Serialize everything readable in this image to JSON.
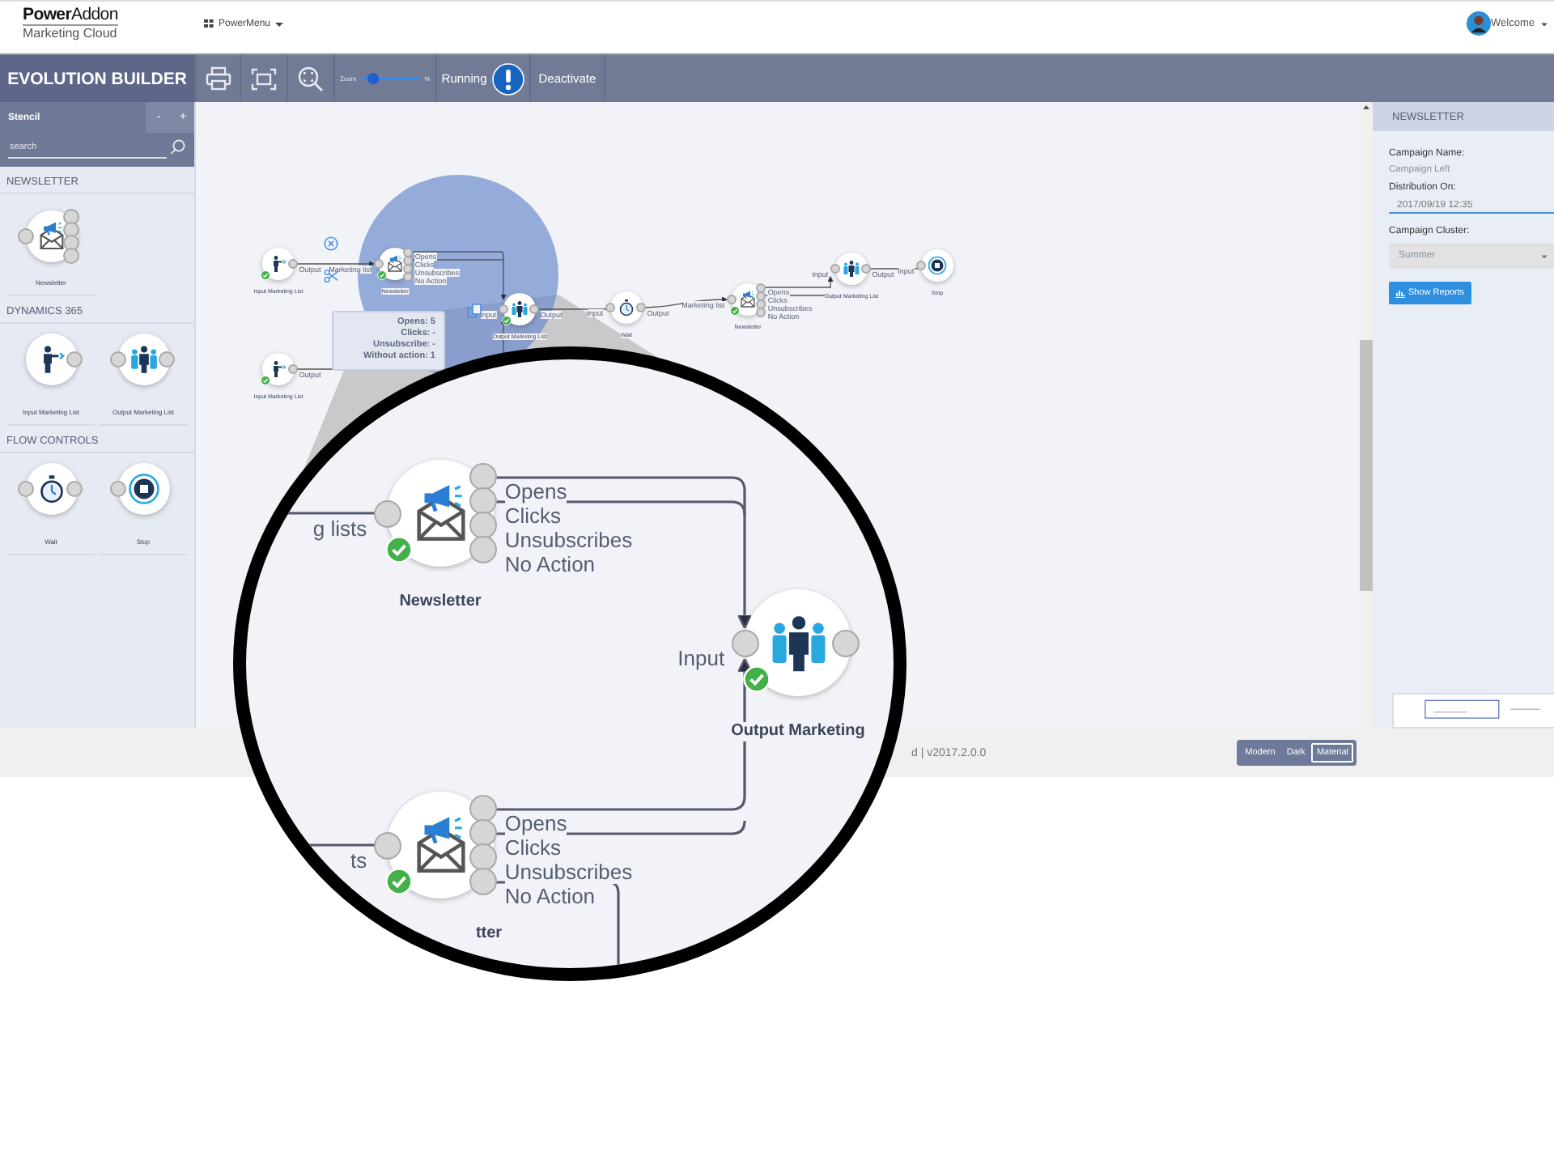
{
  "header": {
    "logo": "**Power**Addon",
    "logo_subtitle": "Marketing Cloud",
    "menu": "PowerMenu",
    "user": "Welcome"
  },
  "toolbar": {
    "title": "EVOLUTION BUILDER",
    "zoom_label": "Zoom",
    "zoom": {
      "level": 0.2
    },
    "zoom_unit": "%",
    "status": "Running",
    "action": "Deactivate"
  },
  "stencil": {
    "title": "Stencil",
    "buttons": [
      "-",
      "+"
    ],
    "search": {
      "placeholder": "search"
    },
    "groups": [
      {
        "title": "NEWSLETTER",
        "items": [
          {
            "kind": "newsletter",
            "label": "Newsletter"
          }
        ]
      },
      {
        "title": "DYNAMICS 365",
        "items": [
          {
            "kind": "input-list",
            "label": "Input Marketing List"
          },
          {
            "kind": "output-list",
            "label": "Output Marketing List"
          }
        ]
      },
      {
        "title": "FLOW CONTROLS",
        "items": [
          {
            "kind": "wait",
            "label": "Wait"
          },
          {
            "kind": "stop",
            "label": "Stop"
          }
        ]
      }
    ]
  },
  "canvas": {
    "nodes": [
      {
        "kind": "input-list",
        "label": "Input Marketing List",
        "done": true,
        "output": "Output"
      },
      {
        "kind": "newsletter",
        "label": "Newsletter",
        "done": true,
        "input": "Marketing list",
        "options": [
          "Opens",
          "Clicks",
          "Unsubscribes",
          "No Action"
        ]
      },
      {
        "kind": "output-list",
        "label": "Output Marketing List",
        "done": true,
        "input": "Input",
        "output": "Output"
      },
      {
        "kind": "wait",
        "label": "Wait",
        "done": false,
        "input": "Input",
        "output": "Output"
      },
      {
        "kind": "newsletter",
        "label": "Newsletter",
        "done": true,
        "input": "Marketing list",
        "options": [
          "Opens",
          "Clicks",
          "Unsubscribes",
          "No Action"
        ]
      },
      {
        "kind": "output-list",
        "label": "Output Marketing List",
        "done": false,
        "input": "Input",
        "output": "Output"
      },
      {
        "kind": "stop",
        "label": "Stop",
        "done": false,
        "input": "Input"
      },
      {
        "kind": "input-list",
        "label": "Input Marketing List",
        "done": true,
        "output": "Output"
      }
    ],
    "tooltip": [
      "Opens: 5",
      "Clicks: -",
      "Unsubscribe: -",
      "Without action: 1"
    ]
  },
  "zoom_view": {
    "nodes": [
      {
        "kind": "newsletter",
        "label": "Newsletter",
        "done": true,
        "input": "g lists",
        "options": [
          "Opens",
          "Clicks",
          "Unsubscribes",
          "No Action"
        ]
      },
      {
        "kind": "output-list",
        "label": "Output Marketing",
        "done": true,
        "input": "Input"
      },
      {
        "kind": "newsletter",
        "label": "tter",
        "done": true,
        "input": "ts",
        "options": [
          "Opens",
          "Clicks",
          "Unsubscribes",
          "No Action"
        ]
      }
    ]
  },
  "properties": {
    "title": "NEWSLETTER",
    "campaign_name": {
      "label": "Campaign Name:",
      "value": "Campaign Left"
    },
    "distribution": {
      "label": "Distribution On:",
      "value": "2017/09/19 12:35"
    },
    "cluster": {
      "label": "Campaign Cluster:",
      "value": "Summer"
    },
    "button": "Show Reports"
  },
  "footer": {
    "version": "d | v2017.2.0.0",
    "themes": [
      {
        "label": "Modern",
        "selected": false
      },
      {
        "label": "Dark",
        "selected": false
      },
      {
        "label": "Material",
        "selected": true
      }
    ]
  }
}
